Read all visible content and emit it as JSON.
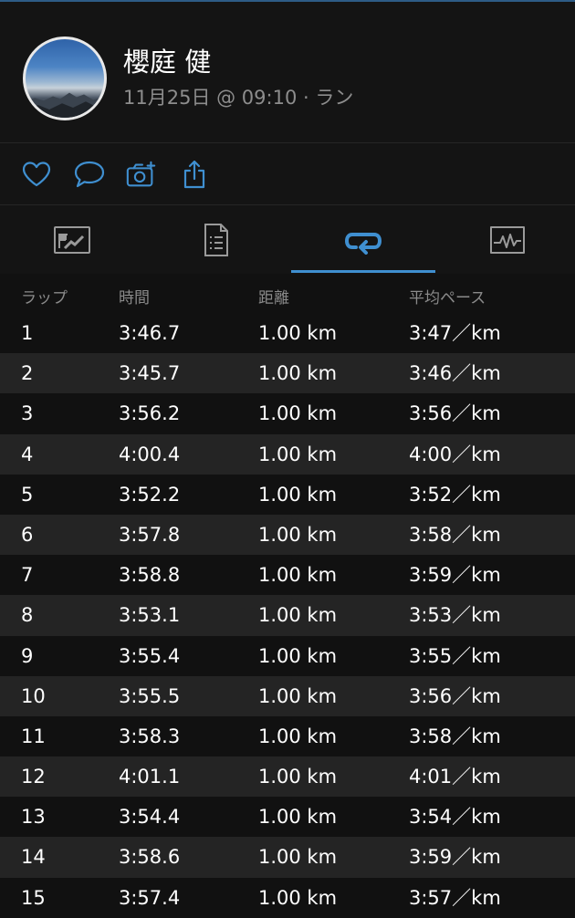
{
  "header": {
    "name": "櫻庭 健",
    "meta": "11月25日 @ 09:10 · ラン"
  },
  "actions": [
    {
      "icon": "heart-icon"
    },
    {
      "icon": "comment-icon"
    },
    {
      "icon": "add-photo-icon"
    },
    {
      "icon": "share-icon"
    }
  ],
  "tabs": [
    {
      "icon": "summary-card-icon",
      "selected": false
    },
    {
      "icon": "details-document-icon",
      "selected": false
    },
    {
      "icon": "laps-loop-icon",
      "selected": true
    },
    {
      "icon": "chart-pulse-icon",
      "selected": false
    }
  ],
  "colors": {
    "accent": "#3f8fd0",
    "background": "#111111",
    "row_alt": "#242424"
  },
  "table": {
    "headers": {
      "lap": "ラップ",
      "time": "時間",
      "distance": "距離",
      "pace": "平均ペース"
    },
    "rows": [
      {
        "lap": "1",
        "time": "3:46.7",
        "distance": "1.00 km",
        "pace": "3:47／km"
      },
      {
        "lap": "2",
        "time": "3:45.7",
        "distance": "1.00 km",
        "pace": "3:46／km"
      },
      {
        "lap": "3",
        "time": "3:56.2",
        "distance": "1.00 km",
        "pace": "3:56／km"
      },
      {
        "lap": "4",
        "time": "4:00.4",
        "distance": "1.00 km",
        "pace": "4:00／km"
      },
      {
        "lap": "5",
        "time": "3:52.2",
        "distance": "1.00 km",
        "pace": "3:52／km"
      },
      {
        "lap": "6",
        "time": "3:57.8",
        "distance": "1.00 km",
        "pace": "3:58／km"
      },
      {
        "lap": "7",
        "time": "3:58.8",
        "distance": "1.00 km",
        "pace": "3:59／km"
      },
      {
        "lap": "8",
        "time": "3:53.1",
        "distance": "1.00 km",
        "pace": "3:53／km"
      },
      {
        "lap": "9",
        "time": "3:55.4",
        "distance": "1.00 km",
        "pace": "3:55／km"
      },
      {
        "lap": "10",
        "time": "3:55.5",
        "distance": "1.00 km",
        "pace": "3:56／km"
      },
      {
        "lap": "11",
        "time": "3:58.3",
        "distance": "1.00 km",
        "pace": "3:58／km"
      },
      {
        "lap": "12",
        "time": "4:01.1",
        "distance": "1.00 km",
        "pace": "4:01／km"
      },
      {
        "lap": "13",
        "time": "3:54.4",
        "distance": "1.00 km",
        "pace": "3:54／km"
      },
      {
        "lap": "14",
        "time": "3:58.6",
        "distance": "1.00 km",
        "pace": "3:59／km"
      },
      {
        "lap": "15",
        "time": "3:57.4",
        "distance": "1.00 km",
        "pace": "3:57／km"
      }
    ]
  }
}
